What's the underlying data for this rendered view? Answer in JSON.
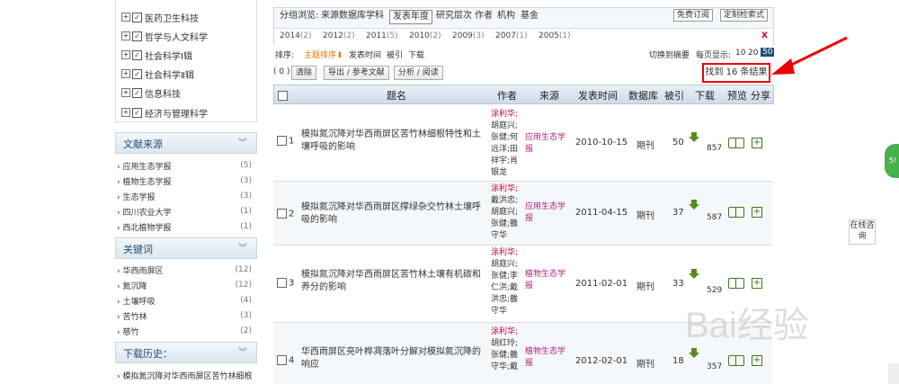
{
  "categories": [
    {
      "label": "医药卫生科技"
    },
    {
      "label": "哲学与人文科学"
    },
    {
      "label": "社会科学Ⅰ辑"
    },
    {
      "label": "社会科学Ⅱ辑"
    },
    {
      "label": "信息科技"
    },
    {
      "label": "经济与管理科学"
    }
  ],
  "sources": {
    "title": "文献来源",
    "items": [
      {
        "label": "应用生态学报",
        "count": "(5)"
      },
      {
        "label": "植物生态学报",
        "count": "(3)"
      },
      {
        "label": "生态学报",
        "count": "(3)"
      },
      {
        "label": "四川农业大学",
        "count": "(1)"
      },
      {
        "label": "西北植物学报",
        "count": "(1)"
      }
    ]
  },
  "keywords": {
    "title": "关键词",
    "items": [
      {
        "label": "华西雨屏区",
        "count": "(12)"
      },
      {
        "label": "氮沉降",
        "count": "(12)"
      },
      {
        "label": "土壤呼吸",
        "count": "(4)"
      },
      {
        "label": "苦竹林",
        "count": "(3)"
      },
      {
        "label": "慈竹",
        "count": "(2)"
      }
    ]
  },
  "history": {
    "title": "下载历史：",
    "items": [
      {
        "label": "模拟氮沉降对华西雨屏区苦竹林细根"
      }
    ]
  },
  "group": {
    "label": "分组浏览:",
    "tabs": [
      "来源数据库",
      "学科",
      "发表年度",
      "研究层次",
      "作者",
      "机构",
      "基金"
    ],
    "free_sub": "免费订阅",
    "custom": "定制检索式"
  },
  "years": [
    {
      "y": "2014",
      "c": "(2)"
    },
    {
      "y": "2012",
      "c": "(2)"
    },
    {
      "y": "2011",
      "c": "(5)"
    },
    {
      "y": "2010",
      "c": "(2)"
    },
    {
      "y": "2009",
      "c": "(3)"
    },
    {
      "y": "2007",
      "c": "(1)"
    },
    {
      "y": "2005",
      "c": "(1)"
    }
  ],
  "close": "X",
  "sort": {
    "label": "排序:",
    "topic": "主题排序",
    "time": "发表时间",
    "cited": "被引",
    "dl": "下载",
    "switch": "切换到摘要",
    "perpage": "每页显示:",
    "p10": "10",
    "p20": "20",
    "p50": "50"
  },
  "actions": {
    "count": "( 0 )",
    "clear": "清除",
    "export": "导出 / 参考文献",
    "analyze": "分析 / 阅读"
  },
  "found": "找到 16 条结果",
  "headers": {
    "title": "题名",
    "author": "作者",
    "source": "来源",
    "date": "发表时间",
    "db": "数据库",
    "cited": "被引",
    "download": "下载",
    "preview": "预览",
    "share": "分享"
  },
  "rows": [
    {
      "n": "1",
      "title": "模拟氮沉降对华西雨屏区苦竹林细根特性和土壤呼吸的影响",
      "a1": "涂利华;",
      "arest": "胡庭兴;张健;何远洋;田祥宇;肖银龙",
      "src": "应用生态学报",
      "date": "2010-10-15",
      "db": "期刊",
      "cited": "50",
      "dl": "857"
    },
    {
      "n": "2",
      "title": "模拟氮沉降对华西雨屏区撑绿杂交竹林土壤呼吸的影响",
      "a1": "涂利华;",
      "arest": "戴洪忠;胡庭兴;张健;雒守华",
      "src": "应用生态学报",
      "date": "2011-04-15",
      "db": "期刊",
      "cited": "37",
      "dl": "587"
    },
    {
      "n": "3",
      "title": "模拟氮沉降对华西雨屏区苦竹林土壤有机碳和养分的影响",
      "a1": "涂利华;",
      "arest": "胡庭兴;张健;李仁洪;戴洪忠;雒守华",
      "src": "植物生态学报",
      "date": "2011-02-01",
      "db": "期刊",
      "cited": "33",
      "dl": "529"
    },
    {
      "n": "4",
      "title": "华西雨屏区亮叶桦凋落叶分解对模拟氮沉降的响应",
      "a1": "涂利华;",
      "arest": "胡红玲;张健;雒守华;戴",
      "src": "植物生态学报",
      "date": "2012-02-01",
      "db": "期刊",
      "cited": "18",
      "dl": "357"
    }
  ],
  "online": "在线咨询",
  "watermark": "Bai经验"
}
